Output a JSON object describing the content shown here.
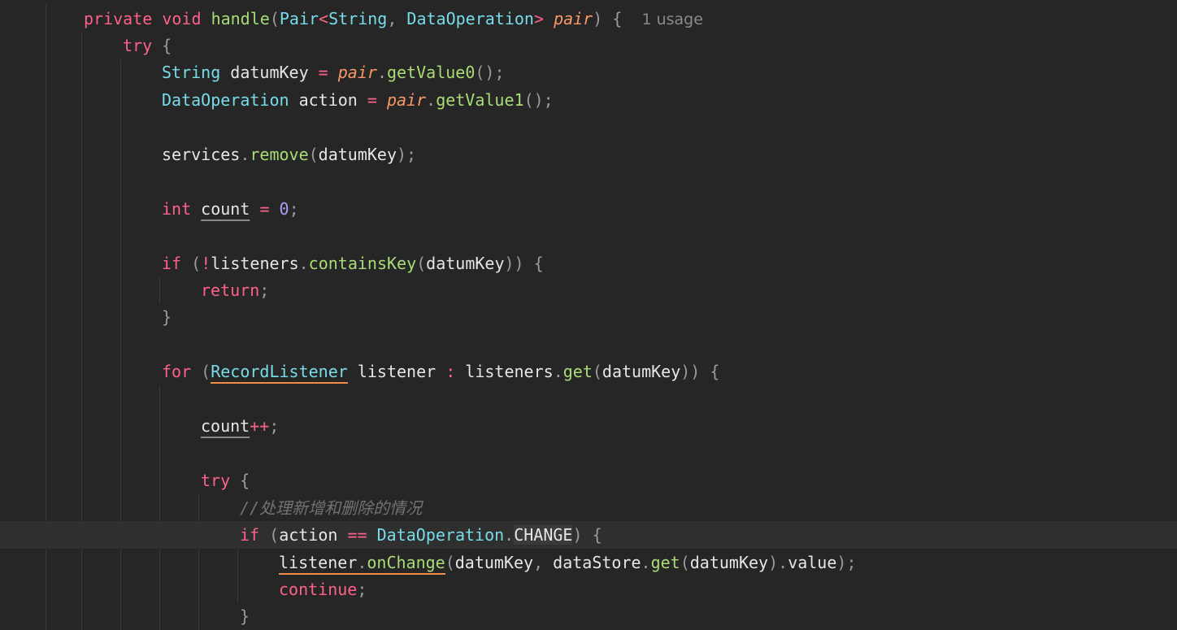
{
  "theme": {
    "background": "#262626",
    "current_line": "#2f2f2f",
    "keyword": "#ff6188",
    "function": "#a9dc76",
    "type": "#78dce8",
    "parameter": "#fc9867",
    "number": "#ab9df2",
    "comment": "#727272"
  },
  "code": {
    "lines": [
      {
        "name": "code-line-method-signature",
        "indent": 2,
        "tokens": [
          {
            "t": "kw",
            "v": "private"
          },
          {
            "t": "id",
            "v": " "
          },
          {
            "t": "kw",
            "v": "void"
          },
          {
            "t": "id",
            "v": " "
          },
          {
            "t": "fn",
            "v": "handle"
          },
          {
            "t": "punc",
            "v": "("
          },
          {
            "t": "ty",
            "v": "Pair"
          },
          {
            "t": "op",
            "v": "<"
          },
          {
            "t": "ty",
            "v": "String"
          },
          {
            "t": "punc",
            "v": ", "
          },
          {
            "t": "ty",
            "v": "DataOperation"
          },
          {
            "t": "op",
            "v": ">"
          },
          {
            "t": "id",
            "v": " "
          },
          {
            "t": "param",
            "v": "pair"
          },
          {
            "t": "punc",
            "v": ")"
          },
          {
            "t": "id",
            "v": " "
          },
          {
            "t": "punc",
            "v": "{"
          },
          {
            "t": "id",
            "v": "  "
          },
          {
            "t": "hint",
            "v": "1 usage",
            "name": "usage-hint"
          }
        ]
      },
      {
        "name": "code-line-try",
        "indent": 3,
        "tokens": [
          {
            "t": "kw",
            "v": "try"
          },
          {
            "t": "id",
            "v": " "
          },
          {
            "t": "punc",
            "v": "{"
          }
        ]
      },
      {
        "name": "code-line-datum-key",
        "indent": 4,
        "tokens": [
          {
            "t": "ty",
            "v": "String"
          },
          {
            "t": "id",
            "v": " datumKey "
          },
          {
            "t": "op",
            "v": "="
          },
          {
            "t": "id",
            "v": " "
          },
          {
            "t": "param",
            "v": "pair"
          },
          {
            "t": "punc",
            "v": "."
          },
          {
            "t": "fn",
            "v": "getValue0"
          },
          {
            "t": "punc",
            "v": "();"
          }
        ]
      },
      {
        "name": "code-line-action",
        "indent": 4,
        "tokens": [
          {
            "t": "ty",
            "v": "DataOperation"
          },
          {
            "t": "id",
            "v": " action "
          },
          {
            "t": "op",
            "v": "="
          },
          {
            "t": "id",
            "v": " "
          },
          {
            "t": "param",
            "v": "pair"
          },
          {
            "t": "punc",
            "v": "."
          },
          {
            "t": "fn",
            "v": "getValue1"
          },
          {
            "t": "punc",
            "v": "();"
          }
        ]
      },
      {
        "name": "code-line-blank",
        "indent": 0,
        "tokens": []
      },
      {
        "name": "code-line-services-remove",
        "indent": 4,
        "tokens": [
          {
            "t": "id",
            "v": "services"
          },
          {
            "t": "punc",
            "v": "."
          },
          {
            "t": "fn",
            "v": "remove"
          },
          {
            "t": "punc",
            "v": "("
          },
          {
            "t": "id",
            "v": "datumKey"
          },
          {
            "t": "punc",
            "v": ");"
          }
        ]
      },
      {
        "name": "code-line-blank",
        "indent": 0,
        "tokens": []
      },
      {
        "name": "code-line-count-decl",
        "indent": 4,
        "tokens": [
          {
            "t": "kw",
            "v": "int"
          },
          {
            "t": "id",
            "v": " "
          },
          {
            "t": "id",
            "v": "count",
            "u": "dotted"
          },
          {
            "t": "id",
            "v": " "
          },
          {
            "t": "op",
            "v": "="
          },
          {
            "t": "id",
            "v": " "
          },
          {
            "t": "num",
            "v": "0"
          },
          {
            "t": "punc",
            "v": ";"
          }
        ]
      },
      {
        "name": "code-line-blank",
        "indent": 0,
        "tokens": []
      },
      {
        "name": "code-line-if-contains",
        "indent": 4,
        "tokens": [
          {
            "t": "kw",
            "v": "if"
          },
          {
            "t": "id",
            "v": " "
          },
          {
            "t": "punc",
            "v": "("
          },
          {
            "t": "op",
            "v": "!"
          },
          {
            "t": "id",
            "v": "listeners"
          },
          {
            "t": "punc",
            "v": "."
          },
          {
            "t": "fn",
            "v": "containsKey"
          },
          {
            "t": "punc",
            "v": "("
          },
          {
            "t": "id",
            "v": "datumKey"
          },
          {
            "t": "punc",
            "v": "))"
          },
          {
            "t": "id",
            "v": " "
          },
          {
            "t": "punc",
            "v": "{"
          }
        ]
      },
      {
        "name": "code-line-return",
        "indent": 5,
        "tokens": [
          {
            "t": "kw",
            "v": "return"
          },
          {
            "t": "punc",
            "v": ";"
          }
        ]
      },
      {
        "name": "code-line-close-brace",
        "indent": 4,
        "tokens": [
          {
            "t": "punc",
            "v": "}"
          }
        ]
      },
      {
        "name": "code-line-blank",
        "indent": 0,
        "tokens": []
      },
      {
        "name": "code-line-for-loop",
        "indent": 4,
        "tokens": [
          {
            "t": "kw",
            "v": "for"
          },
          {
            "t": "id",
            "v": " "
          },
          {
            "t": "punc",
            "v": "("
          },
          {
            "t": "ty",
            "v": "RecordListener",
            "u": "warn"
          },
          {
            "t": "id",
            "v": " listener "
          },
          {
            "t": "op",
            "v": ":"
          },
          {
            "t": "id",
            "v": " listeners"
          },
          {
            "t": "punc",
            "v": "."
          },
          {
            "t": "fn",
            "v": "get"
          },
          {
            "t": "punc",
            "v": "("
          },
          {
            "t": "id",
            "v": "datumKey"
          },
          {
            "t": "punc",
            "v": "))"
          },
          {
            "t": "id",
            "v": " "
          },
          {
            "t": "punc",
            "v": "{"
          }
        ]
      },
      {
        "name": "code-line-blank",
        "indent": 0,
        "tokens": []
      },
      {
        "name": "code-line-count-increment",
        "indent": 5,
        "tokens": [
          {
            "t": "id",
            "v": "count",
            "u": "dotted"
          },
          {
            "t": "op",
            "v": "++"
          },
          {
            "t": "punc",
            "v": ";"
          }
        ]
      },
      {
        "name": "code-line-blank",
        "indent": 0,
        "tokens": []
      },
      {
        "name": "code-line-inner-try",
        "indent": 5,
        "tokens": [
          {
            "t": "kw",
            "v": "try"
          },
          {
            "t": "id",
            "v": " "
          },
          {
            "t": "punc",
            "v": "{"
          }
        ]
      },
      {
        "name": "code-line-comment",
        "indent": 6,
        "tokens": [
          {
            "t": "cm",
            "v": "//处理新增和删除的情况"
          }
        ]
      },
      {
        "name": "code-line-if-change",
        "indent": 6,
        "current": true,
        "tokens": [
          {
            "t": "kw",
            "v": "if"
          },
          {
            "t": "id",
            "v": " "
          },
          {
            "t": "punc",
            "v": "("
          },
          {
            "t": "id",
            "v": "action "
          },
          {
            "t": "op",
            "v": "=="
          },
          {
            "t": "id",
            "v": " "
          },
          {
            "t": "ty",
            "v": "DataOperation"
          },
          {
            "t": "punc",
            "v": "."
          },
          {
            "t": "id",
            "v": "CHANGE",
            "u": "box"
          },
          {
            "t": "punc",
            "v": ")"
          },
          {
            "t": "id",
            "v": " "
          },
          {
            "t": "punc",
            "v": "{"
          }
        ]
      },
      {
        "name": "code-line-on-change",
        "indent": 7,
        "tokens": [
          {
            "t": "id",
            "v": "listener",
            "u": "warn"
          },
          {
            "t": "punc",
            "v": ".",
            "u": "warn"
          },
          {
            "t": "fn",
            "v": "onChange",
            "u": "warn"
          },
          {
            "t": "punc",
            "v": "("
          },
          {
            "t": "id",
            "v": "datumKey"
          },
          {
            "t": "punc",
            "v": ", "
          },
          {
            "t": "id",
            "v": "dataStore"
          },
          {
            "t": "punc",
            "v": "."
          },
          {
            "t": "fn",
            "v": "get"
          },
          {
            "t": "punc",
            "v": "("
          },
          {
            "t": "id",
            "v": "datumKey"
          },
          {
            "t": "punc",
            "v": ")."
          },
          {
            "t": "id",
            "v": "value"
          },
          {
            "t": "punc",
            "v": ");"
          }
        ]
      },
      {
        "name": "code-line-continue",
        "indent": 7,
        "tokens": [
          {
            "t": "kw",
            "v": "continue"
          },
          {
            "t": "punc",
            "v": ";"
          }
        ]
      },
      {
        "name": "code-line-close-brace",
        "indent": 6,
        "tokens": [
          {
            "t": "punc",
            "v": "}"
          }
        ]
      }
    ]
  }
}
